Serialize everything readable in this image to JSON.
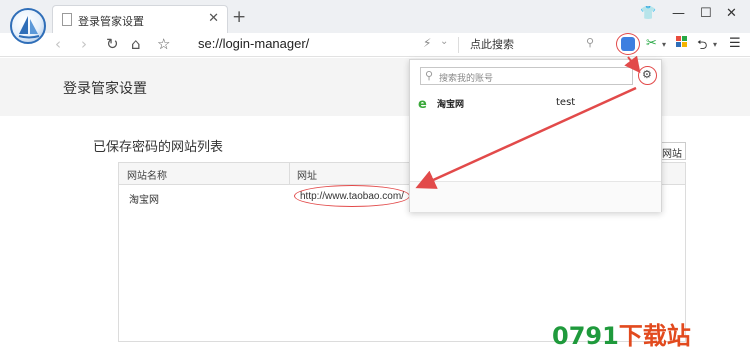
{
  "tab": {
    "title": "登录管家设置"
  },
  "toolbar": {
    "address": "se://login-manager/",
    "search_placeholder": "点此搜索",
    "icons": [
      "back-icon",
      "forward-icon",
      "refresh-icon",
      "home-icon",
      "star-icon",
      "bolt-icon",
      "magnifier-icon",
      "key-icon",
      "scissors-icon",
      "apps-icon",
      "undo-icon",
      "menu-icon"
    ]
  },
  "page": {
    "title": "登录管家设置",
    "section_title": "已保存密码的网站列表",
    "add_site_button": "网站",
    "table": {
      "columns": [
        "网站名称",
        "网址"
      ],
      "rows": [
        {
          "name": "淘宝网",
          "url": "http://www.taobao.com/"
        }
      ]
    }
  },
  "popup": {
    "search_placeholder": "搜索我的账号",
    "accounts": [
      {
        "site": "淘宝网",
        "user": "test"
      }
    ]
  },
  "colors": {
    "annotation": "#e24a4a",
    "brand_blue": "#2f6eb8",
    "watermark_green": "#1f9a3c",
    "watermark_orange": "#e24a1e"
  },
  "watermark": {
    "prefix": "0791",
    "suffix": "下载站"
  }
}
